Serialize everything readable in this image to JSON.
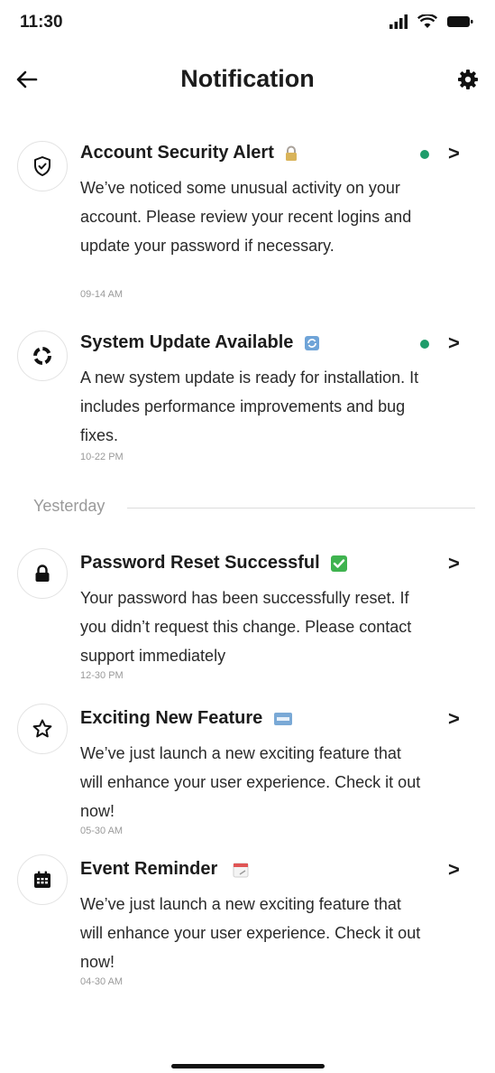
{
  "status": {
    "time": "11:30"
  },
  "header": {
    "title": "Notification"
  },
  "notifications": [
    {
      "title": "Account Security Alert",
      "body": "We’ve noticed some unusual activity on your account. Please review your recent logins and update your password if necessary.",
      "time": "09-14 AM",
      "unread": true,
      "icon": "shield-check-icon"
    },
    {
      "title": "System Update Available",
      "body": "A new system update is ready for installation. It includes performance improvements and bug fixes.",
      "time": "10-22 PM",
      "unread": true,
      "icon": "update-icon"
    },
    {
      "title": "Password Reset Successful",
      "body": "Your password has been successfully reset. If you didn’t request this change. Please contact support immediately",
      "time": "12-30 PM",
      "unread": false,
      "icon": "lock-icon"
    },
    {
      "title": "Exciting New Feature",
      "body": "We’ve just launch a new exciting feature that will enhance your user experience. Check it out now!",
      "time": "05-30 AM",
      "unread": false,
      "icon": "star-icon"
    },
    {
      "title": "Event Reminder",
      "body": "We’ve just launch a new exciting feature that will enhance your user experience. Check it out now!",
      "time": "04-30 AM",
      "unread": false,
      "icon": "calendar-icon"
    }
  ],
  "sections": {
    "yesterday": "Yesterday"
  },
  "colors": {
    "unread_dot": "#1f9d6b",
    "accent_text": "#1c1c1c",
    "muted": "#9a9a9a"
  },
  "glyphs": {
    "chevron": ">"
  }
}
